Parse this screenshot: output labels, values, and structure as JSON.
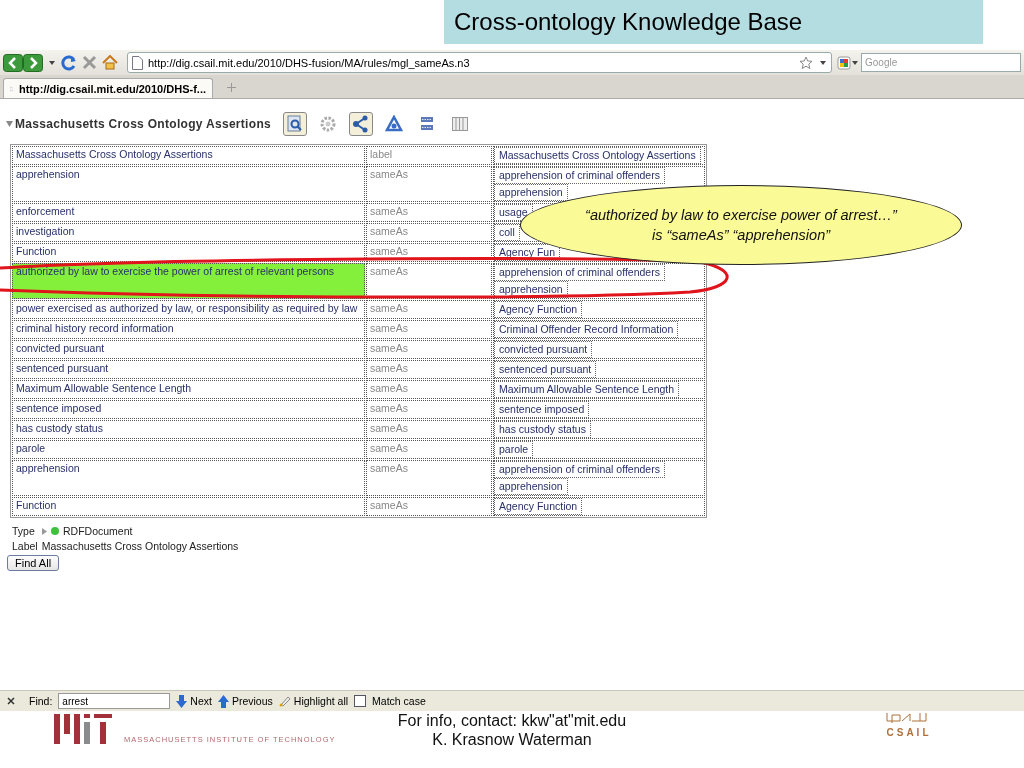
{
  "slide": {
    "title": "Cross-ontology Knowledge Base"
  },
  "browser": {
    "url": "http://dig.csail.mit.edu/2010/DHS-fusion/MA/rules/mgl_sameAs.n3",
    "search_placeholder": "Google",
    "tabs": [
      {
        "title": "http://dig.csail.mit.edu/2010/DHS-f...",
        "selected": true
      }
    ]
  },
  "page": {
    "heading": "Massachusetts Cross Ontology Assertions",
    "expanded": true,
    "views": [
      {
        "selected": true
      },
      {
        "selected": false
      },
      {
        "selected": true
      },
      {
        "selected": false
      },
      {
        "selected": false
      },
      {
        "selected": false
      }
    ],
    "rows": [
      {
        "subject": "Massachusetts Cross Ontology Assertions",
        "predicate": "label",
        "objects": [
          "Massachusetts Cross Ontology Assertions"
        ],
        "highlighted": false
      },
      {
        "subject": "apprehension",
        "predicate": "sameAs",
        "objects": [
          "apprehension of criminal offenders",
          "apprehension"
        ],
        "highlighted": false
      },
      {
        "subject": "enforcement",
        "predicate": "sameAs",
        "objects": [
          "usage"
        ],
        "highlighted": false
      },
      {
        "subject": "investigation",
        "predicate": "sameAs",
        "objects": [
          "coll"
        ],
        "highlighted": false
      },
      {
        "subject": "Function",
        "predicate": "sameAs",
        "objects": [
          "Agency Fun"
        ],
        "highlighted": false
      },
      {
        "subject": "authorized by law to exercise the power of arrest of relevant persons",
        "predicate": "sameAs",
        "objects": [
          "apprehension of criminal offenders",
          "apprehension"
        ],
        "highlighted": true
      },
      {
        "subject": "power exercised as authorized by law, or responsibility as required by law",
        "predicate": "sameAs",
        "objects": [
          "Agency Function"
        ],
        "highlighted": false
      },
      {
        "subject": "criminal history record information",
        "predicate": "sameAs",
        "objects": [
          "Criminal Offender Record Information"
        ],
        "highlighted": false
      },
      {
        "subject": "convicted pursuant",
        "predicate": "sameAs",
        "objects": [
          "convicted pursuant"
        ],
        "highlighted": false
      },
      {
        "subject": "sentenced pursuant",
        "predicate": "sameAs",
        "objects": [
          "sentenced pursuant"
        ],
        "highlighted": false
      },
      {
        "subject": "Maximum Allowable Sentence Length",
        "predicate": "sameAs",
        "objects": [
          "Maximum Allowable Sentence Length"
        ],
        "highlighted": false
      },
      {
        "subject": "sentence imposed",
        "predicate": "sameAs",
        "objects": [
          "sentence imposed"
        ],
        "highlighted": false
      },
      {
        "subject": "has custody status",
        "predicate": "sameAs",
        "objects": [
          "has custody status"
        ],
        "highlighted": false
      },
      {
        "subject": "parole",
        "predicate": "sameAs",
        "objects": [
          "parole"
        ],
        "highlighted": false
      },
      {
        "subject": "apprehension",
        "predicate": "sameAs",
        "objects": [
          "apprehension of criminal offenders",
          "apprehension"
        ],
        "highlighted": false
      },
      {
        "subject": "Function",
        "predicate": "sameAs",
        "objects": [
          "Agency Function"
        ],
        "highlighted": false
      }
    ],
    "type_label": "Type",
    "type_value": "RDFDocument",
    "label_label": "Label",
    "label_value": "Massachusetts Cross Ontology Assertions",
    "find_all": "Find All"
  },
  "find_bar": {
    "label": "Find:",
    "value": "arrest",
    "next": "Next",
    "previous": "Previous",
    "highlight_all": "Highlight all",
    "match_case": {
      "label": "Match case",
      "checked": false
    }
  },
  "callout": {
    "lines": [
      "“authorized by law to exercise power of arrest…”",
      "is “sameAs” “apprehension”"
    ]
  },
  "footer": {
    "institute": "MASSACHUSETTS INSTITUTE OF TECHNOLOGY",
    "contact": "For info, contact: kkw\"at\"mit.edu",
    "author": "K. Krasnow Waterman",
    "lab": "CSAIL"
  }
}
